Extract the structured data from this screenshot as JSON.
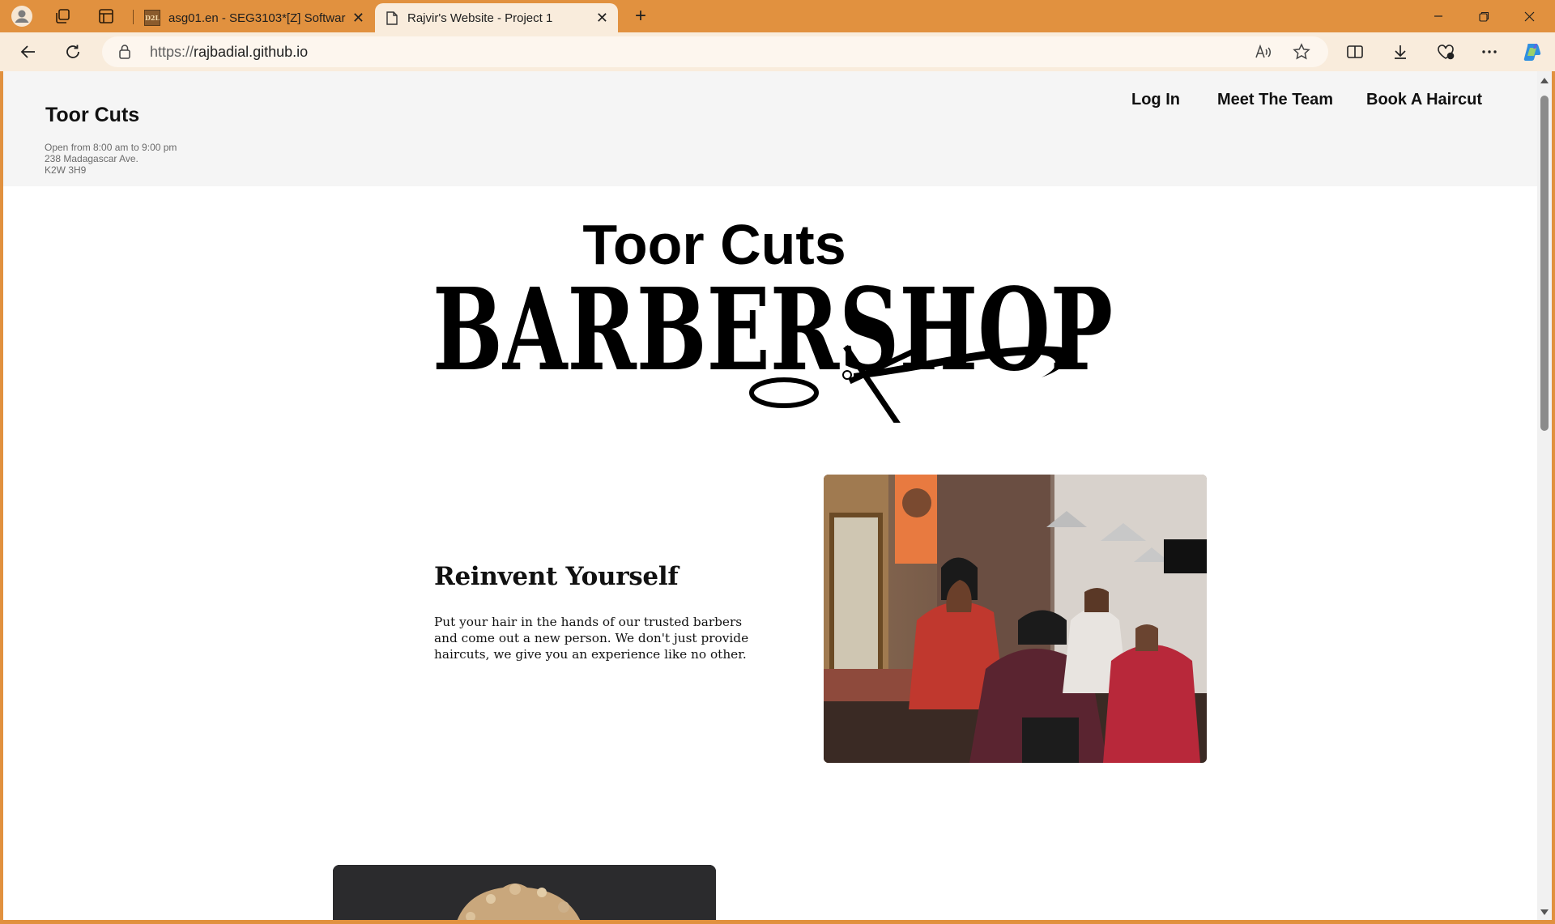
{
  "browser": {
    "tabs": [
      {
        "title": "asg01.en - SEG3103*[Z] Software",
        "favicon": "D2L",
        "active": false
      },
      {
        "title": "Rajvir's Website - Project 1",
        "favicon": "page-icon",
        "active": true
      }
    ],
    "url_protocol": "https://",
    "url_host": "rajbadial.github.io"
  },
  "site": {
    "brand": "Toor Cuts",
    "hours": "Open from 8:00 am to 9:00 pm",
    "address": "238 Madagascar Ave.",
    "postal": "K2W 3H9",
    "nav": [
      "Log In",
      "Meet The Team",
      "Book A Haircut"
    ],
    "logo": {
      "top": "Toor Cuts",
      "main": "BARBERSHOP"
    },
    "hero": {
      "title": "Reinvent Yourself",
      "text": "Put your hair in the hands of our trusted barbers and come out a new person. We don't just provide haircuts, we give you an experience like no other."
    }
  },
  "colors": {
    "chrome": "#e1913f",
    "toolbar": "#f9ecdc",
    "header_bg": "#f5f5f5",
    "text": "#111111"
  }
}
